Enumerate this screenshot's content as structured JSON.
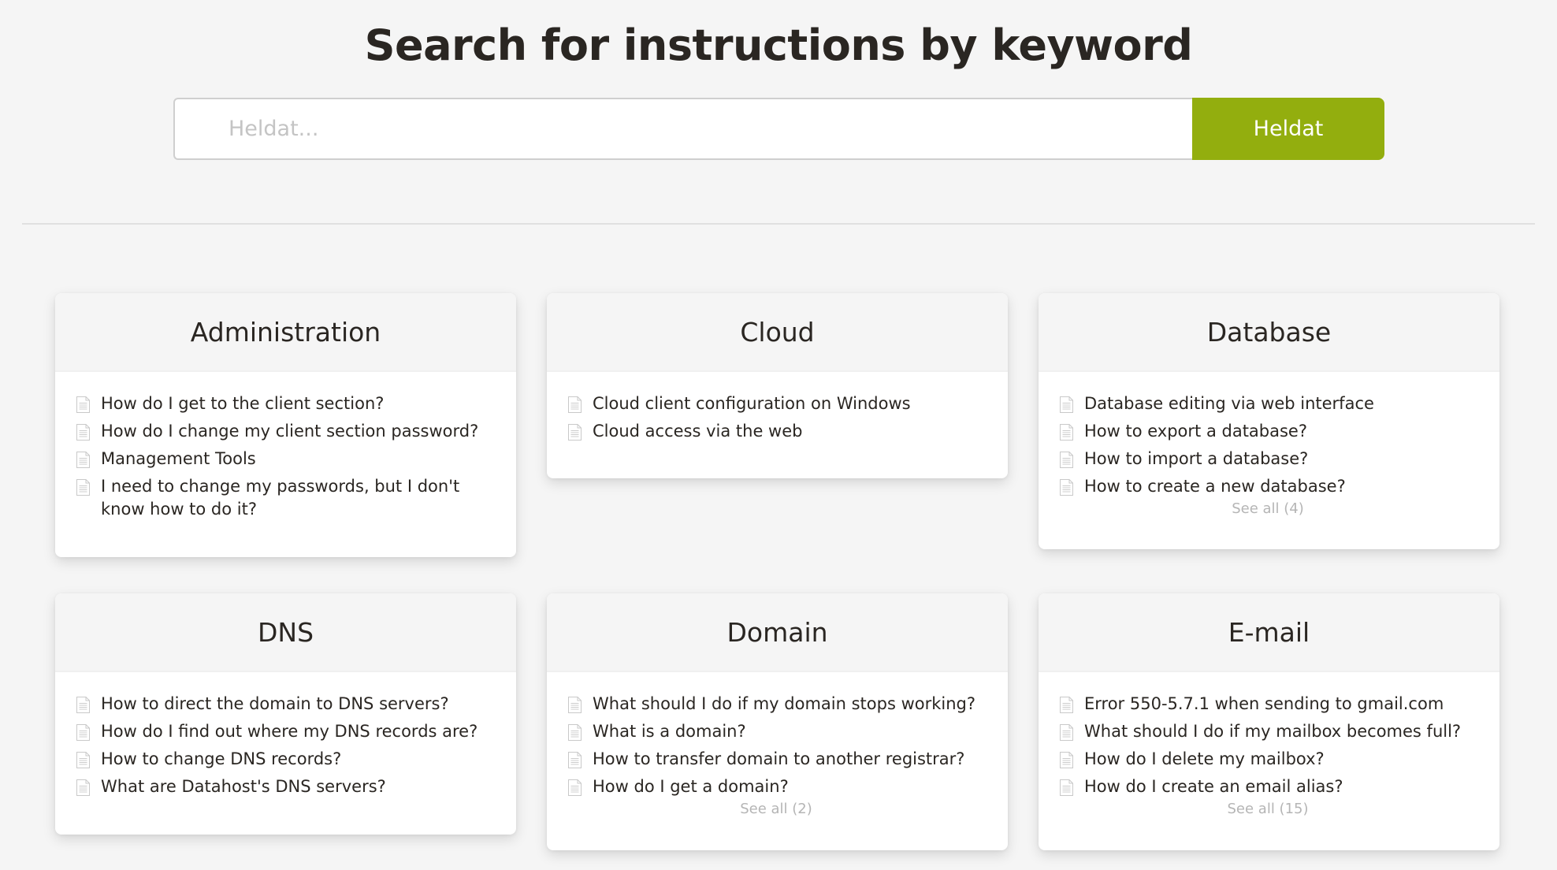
{
  "header": {
    "title": "Search for instructions by keyword"
  },
  "search": {
    "placeholder": "Heldat...",
    "value": "",
    "button_label": "Heldat"
  },
  "colors": {
    "accent": "#93ae0e",
    "background": "#f5f5f5",
    "text": "#2a2622",
    "muted": "#b5b5b5"
  },
  "categories": [
    {
      "title": "Administration",
      "articles": [
        "How do I get to the client section?",
        "How do I change my client section password?",
        "Management Tools",
        "I need to change my passwords, but I don't know how to do it?"
      ],
      "see_all": ""
    },
    {
      "title": "Cloud",
      "articles": [
        "Cloud client configuration on Windows",
        "Cloud access via the web"
      ],
      "see_all": ""
    },
    {
      "title": "Database",
      "articles": [
        "Database editing via web interface",
        "How to export a database?",
        "How to import a database?",
        "How to create a new database?"
      ],
      "see_all": "See all (4)"
    },
    {
      "title": "DNS",
      "articles": [
        "How to direct the domain to DNS servers?",
        "How do I find out where my DNS records are?",
        "How to change DNS records?",
        "What are Datahost's DNS servers?"
      ],
      "see_all": ""
    },
    {
      "title": "Domain",
      "articles": [
        "What should I do if my domain stops working?",
        "What is a domain?",
        "How to transfer domain to another registrar?",
        "How do I get a domain?"
      ],
      "see_all": "See all (2)"
    },
    {
      "title": "E-mail",
      "articles": [
        "Error 550-5.7.1 when sending to gmail.com",
        "What should I do if my mailbox becomes full?",
        "How do I delete my mailbox?",
        "How do I create an email alias?"
      ],
      "see_all": "See all (15)"
    }
  ],
  "icons": {
    "article": "document-icon"
  }
}
